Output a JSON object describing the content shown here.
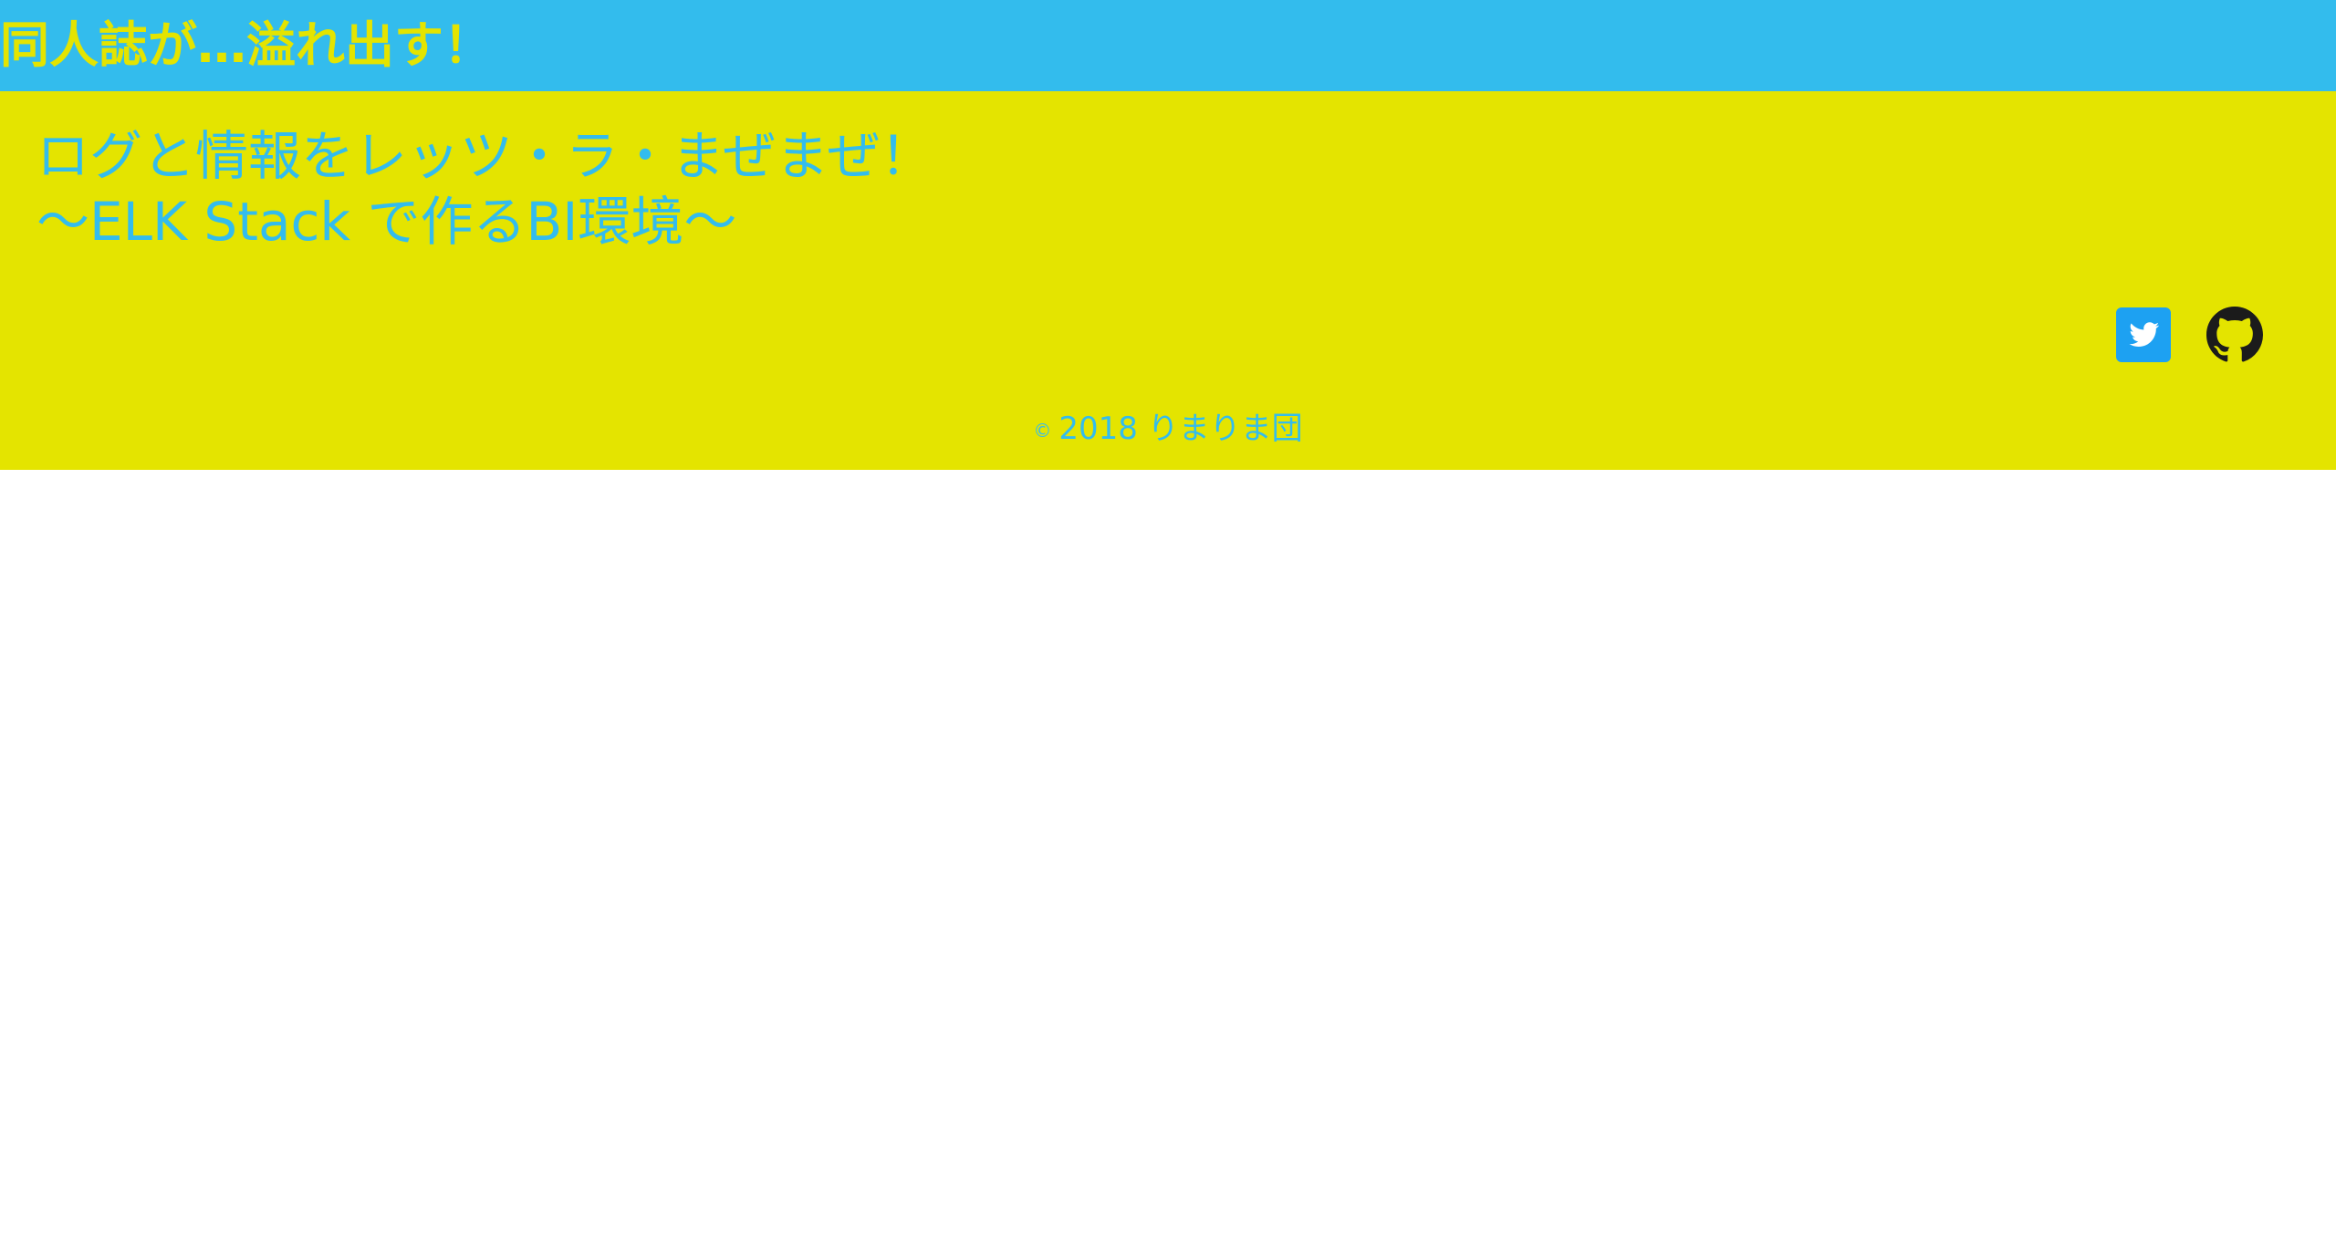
{
  "header": {
    "site_title": "同人誌が…溢れ出す！"
  },
  "main": {
    "book_title_line1": "ログと情報をレッツ・ラ・まぜまぜ！",
    "book_title_line2": "〜ELK Stack で作るBI環境〜"
  },
  "social": {
    "twitter_icon": "twitter-icon",
    "github_icon": "github-icon"
  },
  "footer": {
    "copyright_mark": "©",
    "copyright_text": "2018 りまりま団"
  },
  "colors": {
    "header_bg": "#33bced",
    "main_bg": "#e4e400",
    "text_blue": "#33bced",
    "text_yellow": "#e4e400",
    "twitter_blue": "#1da1f2",
    "github_black": "#1b1b1b"
  }
}
